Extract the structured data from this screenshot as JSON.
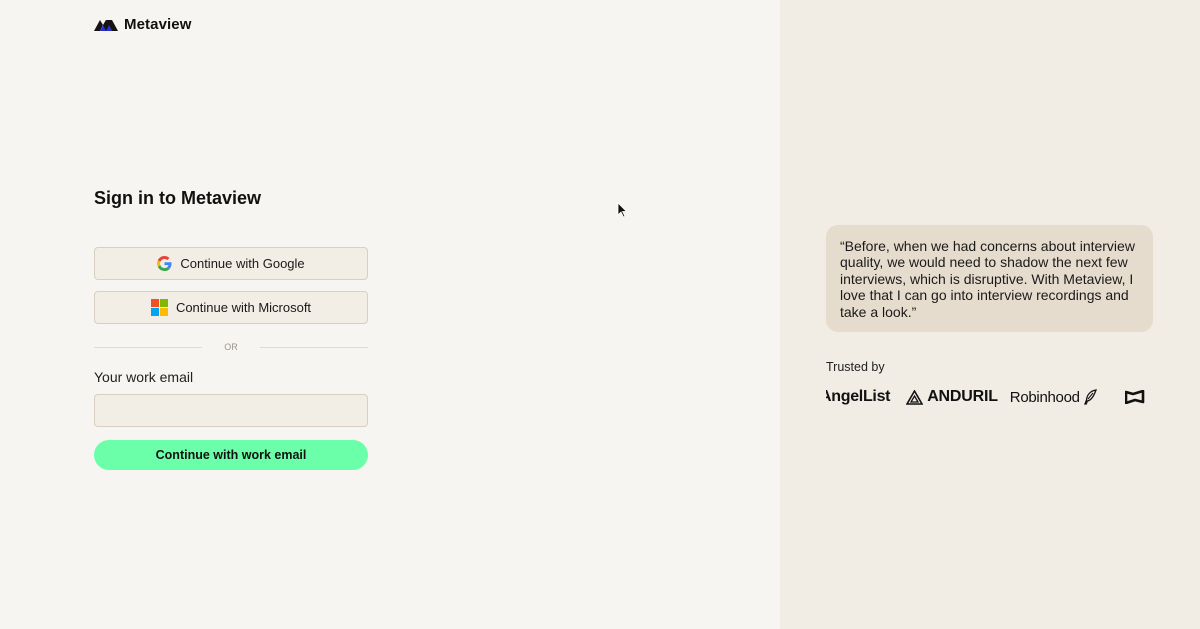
{
  "brand": {
    "name": "Metaview",
    "icon": "metaview-logo-icon"
  },
  "signin": {
    "title": "Sign in to Metaview",
    "google_label": "Continue with Google",
    "microsoft_label": "Continue with Microsoft",
    "divider_text": "OR",
    "email_label": "Your work email",
    "email_value": "",
    "email_placeholder": "",
    "submit_label": "Continue with work email"
  },
  "testimonial": {
    "quote": "“Before, when we had concerns about interview quality, we would need to shadow the next few interviews, which is disruptive. With Metaview, I love that I can go into interview recordings and take a look.”"
  },
  "trusted": {
    "label": "Trusted by",
    "logos": [
      "AngelList",
      "ANDURIL",
      "Robinhood"
    ]
  },
  "colors": {
    "left_bg": "#f7f5f1",
    "right_bg": "#f1ece4",
    "quote_bg": "#e6dccd",
    "button_bg": "#f2ede5",
    "primary": "#6affa8",
    "border": "#d9cfc0"
  }
}
